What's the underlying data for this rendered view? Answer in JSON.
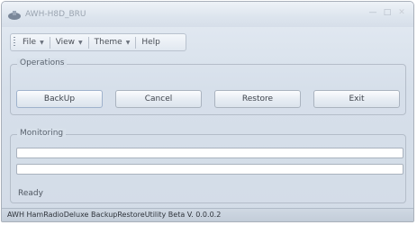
{
  "window": {
    "title": "AWH-H8D_BRU"
  },
  "menu": {
    "items": [
      {
        "label": "File",
        "has_dropdown": true
      },
      {
        "label": "View",
        "has_dropdown": true
      },
      {
        "label": "Theme",
        "has_dropdown": true
      },
      {
        "label": "Help",
        "has_dropdown": false
      }
    ]
  },
  "operations": {
    "legend": "Operations",
    "buttons": [
      "BackUp",
      "Cancel",
      "Restore",
      "Exit"
    ]
  },
  "monitoring": {
    "legend": "Monitoring",
    "progress": [
      0,
      0
    ],
    "status": "Ready"
  },
  "statusbar": {
    "text": "AWH HamRadioDeluxe BackupRestoreUtility Beta V. 0.0.0.2"
  },
  "colors": {
    "accent": "#6fbf5a",
    "frame": "#d6dfea",
    "border": "#b4bdc9"
  }
}
